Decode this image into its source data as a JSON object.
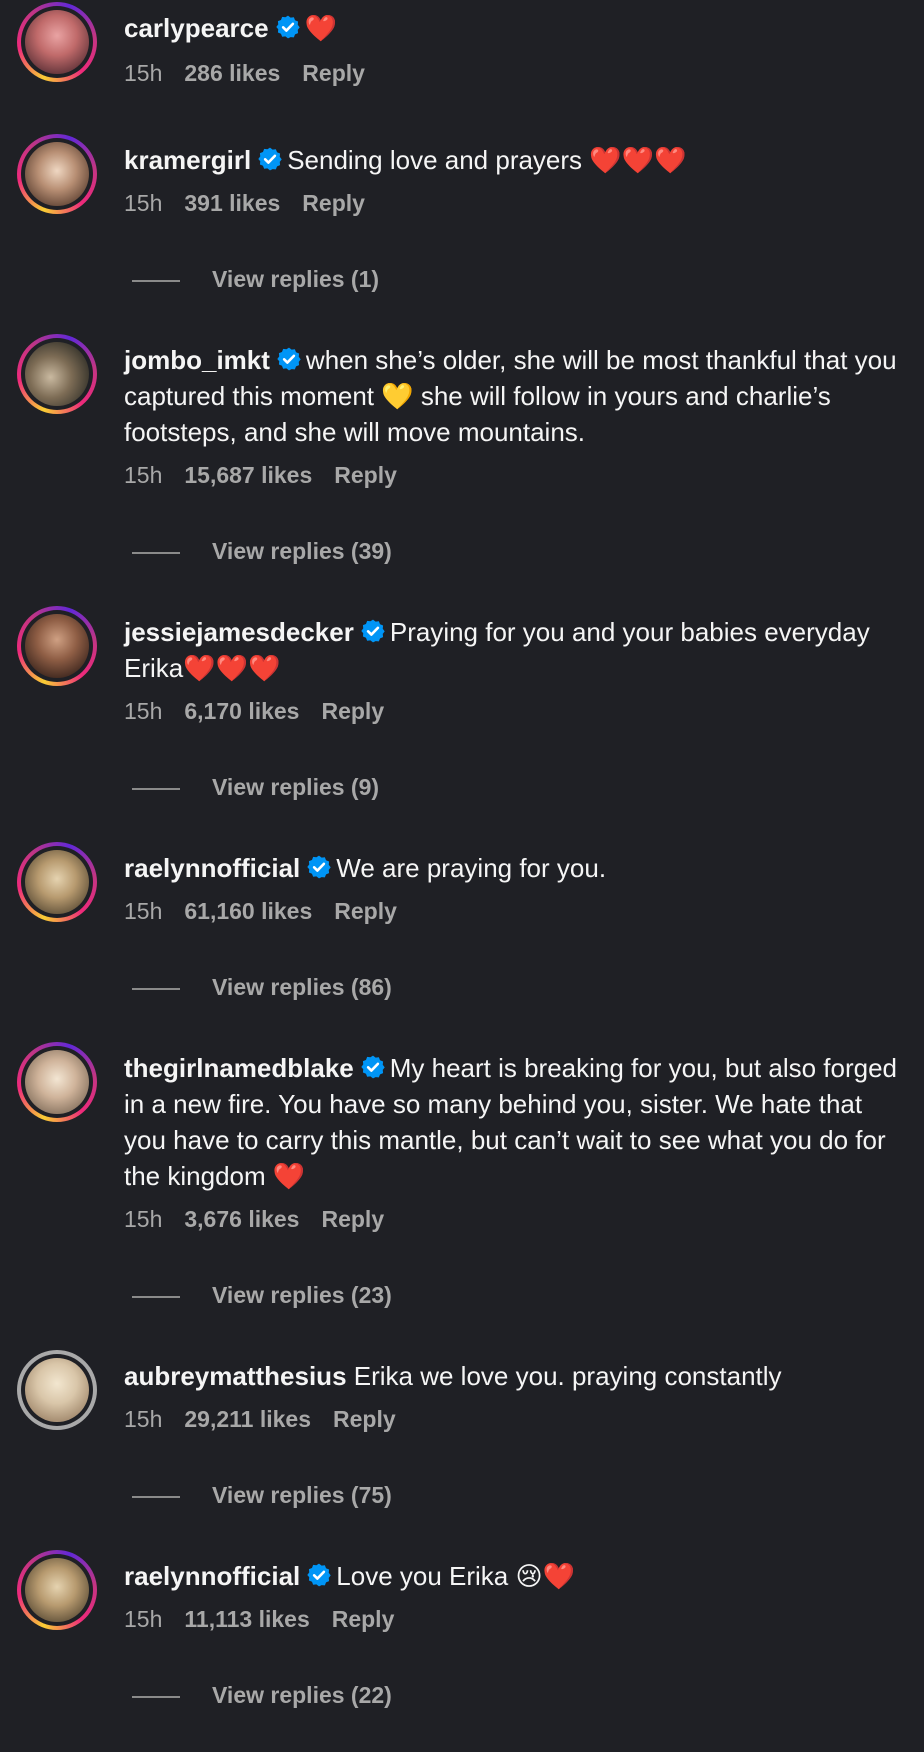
{
  "comments": [
    {
      "username": "carlypearce",
      "verified": true,
      "text": "❤️",
      "time": "15h",
      "likes": "286 likes",
      "reply": "Reply",
      "view_replies": ""
    },
    {
      "username": "kramergirl",
      "verified": true,
      "text": "Sending love and prayers ❤️❤️❤️",
      "time": "15h",
      "likes": "391 likes",
      "reply": "Reply",
      "view_replies": "View replies (1)"
    },
    {
      "username": "jombo_imkt",
      "verified": true,
      "text": "when she’s older, she will be most thankful that you captured this moment 💛 she will follow in yours and charlie’s footsteps, and she will move mountains.",
      "time": "15h",
      "likes": "15,687 likes",
      "reply": "Reply",
      "view_replies": "View replies (39)"
    },
    {
      "username": "jessiejamesdecker",
      "verified": true,
      "text": "Praying for you and your babies everyday Erika❤️❤️❤️",
      "time": "15h",
      "likes": "6,170 likes",
      "reply": "Reply",
      "view_replies": "View replies (9)"
    },
    {
      "username": "raelynnofficial",
      "verified": true,
      "text": "We are praying for you.",
      "time": "15h",
      "likes": "61,160 likes",
      "reply": "Reply",
      "view_replies": "View replies (86)"
    },
    {
      "username": "thegirlnamedblake",
      "verified": true,
      "text": "My heart is breaking for you, but also forged in a new fire. You have so many behind you, sister. We hate that you have to carry this mantle, but can’t wait to see what you do for the kingdom ❤️",
      "time": "15h",
      "likes": "3,676 likes",
      "reply": "Reply",
      "view_replies": "View replies (23)"
    },
    {
      "username": "aubreymatthesius",
      "verified": false,
      "text": "Erika we love you. praying constantly",
      "time": "15h",
      "likes": "29,211 likes",
      "reply": "Reply",
      "view_replies": "View replies (75)"
    },
    {
      "username": "raelynnofficial",
      "verified": true,
      "text": "Love you Erika 😢❤️",
      "time": "15h",
      "likes": "11,113 likes",
      "reply": "Reply",
      "view_replies": "View replies (22)"
    }
  ],
  "colors": {
    "background": "#1f2025",
    "text": "#f5f5f5",
    "muted": "#a8a8a8",
    "verified_badge": "#0095f6"
  },
  "icons": {
    "verified": "verified-badge-icon",
    "avatar_ring": "story-ring-gradient"
  }
}
